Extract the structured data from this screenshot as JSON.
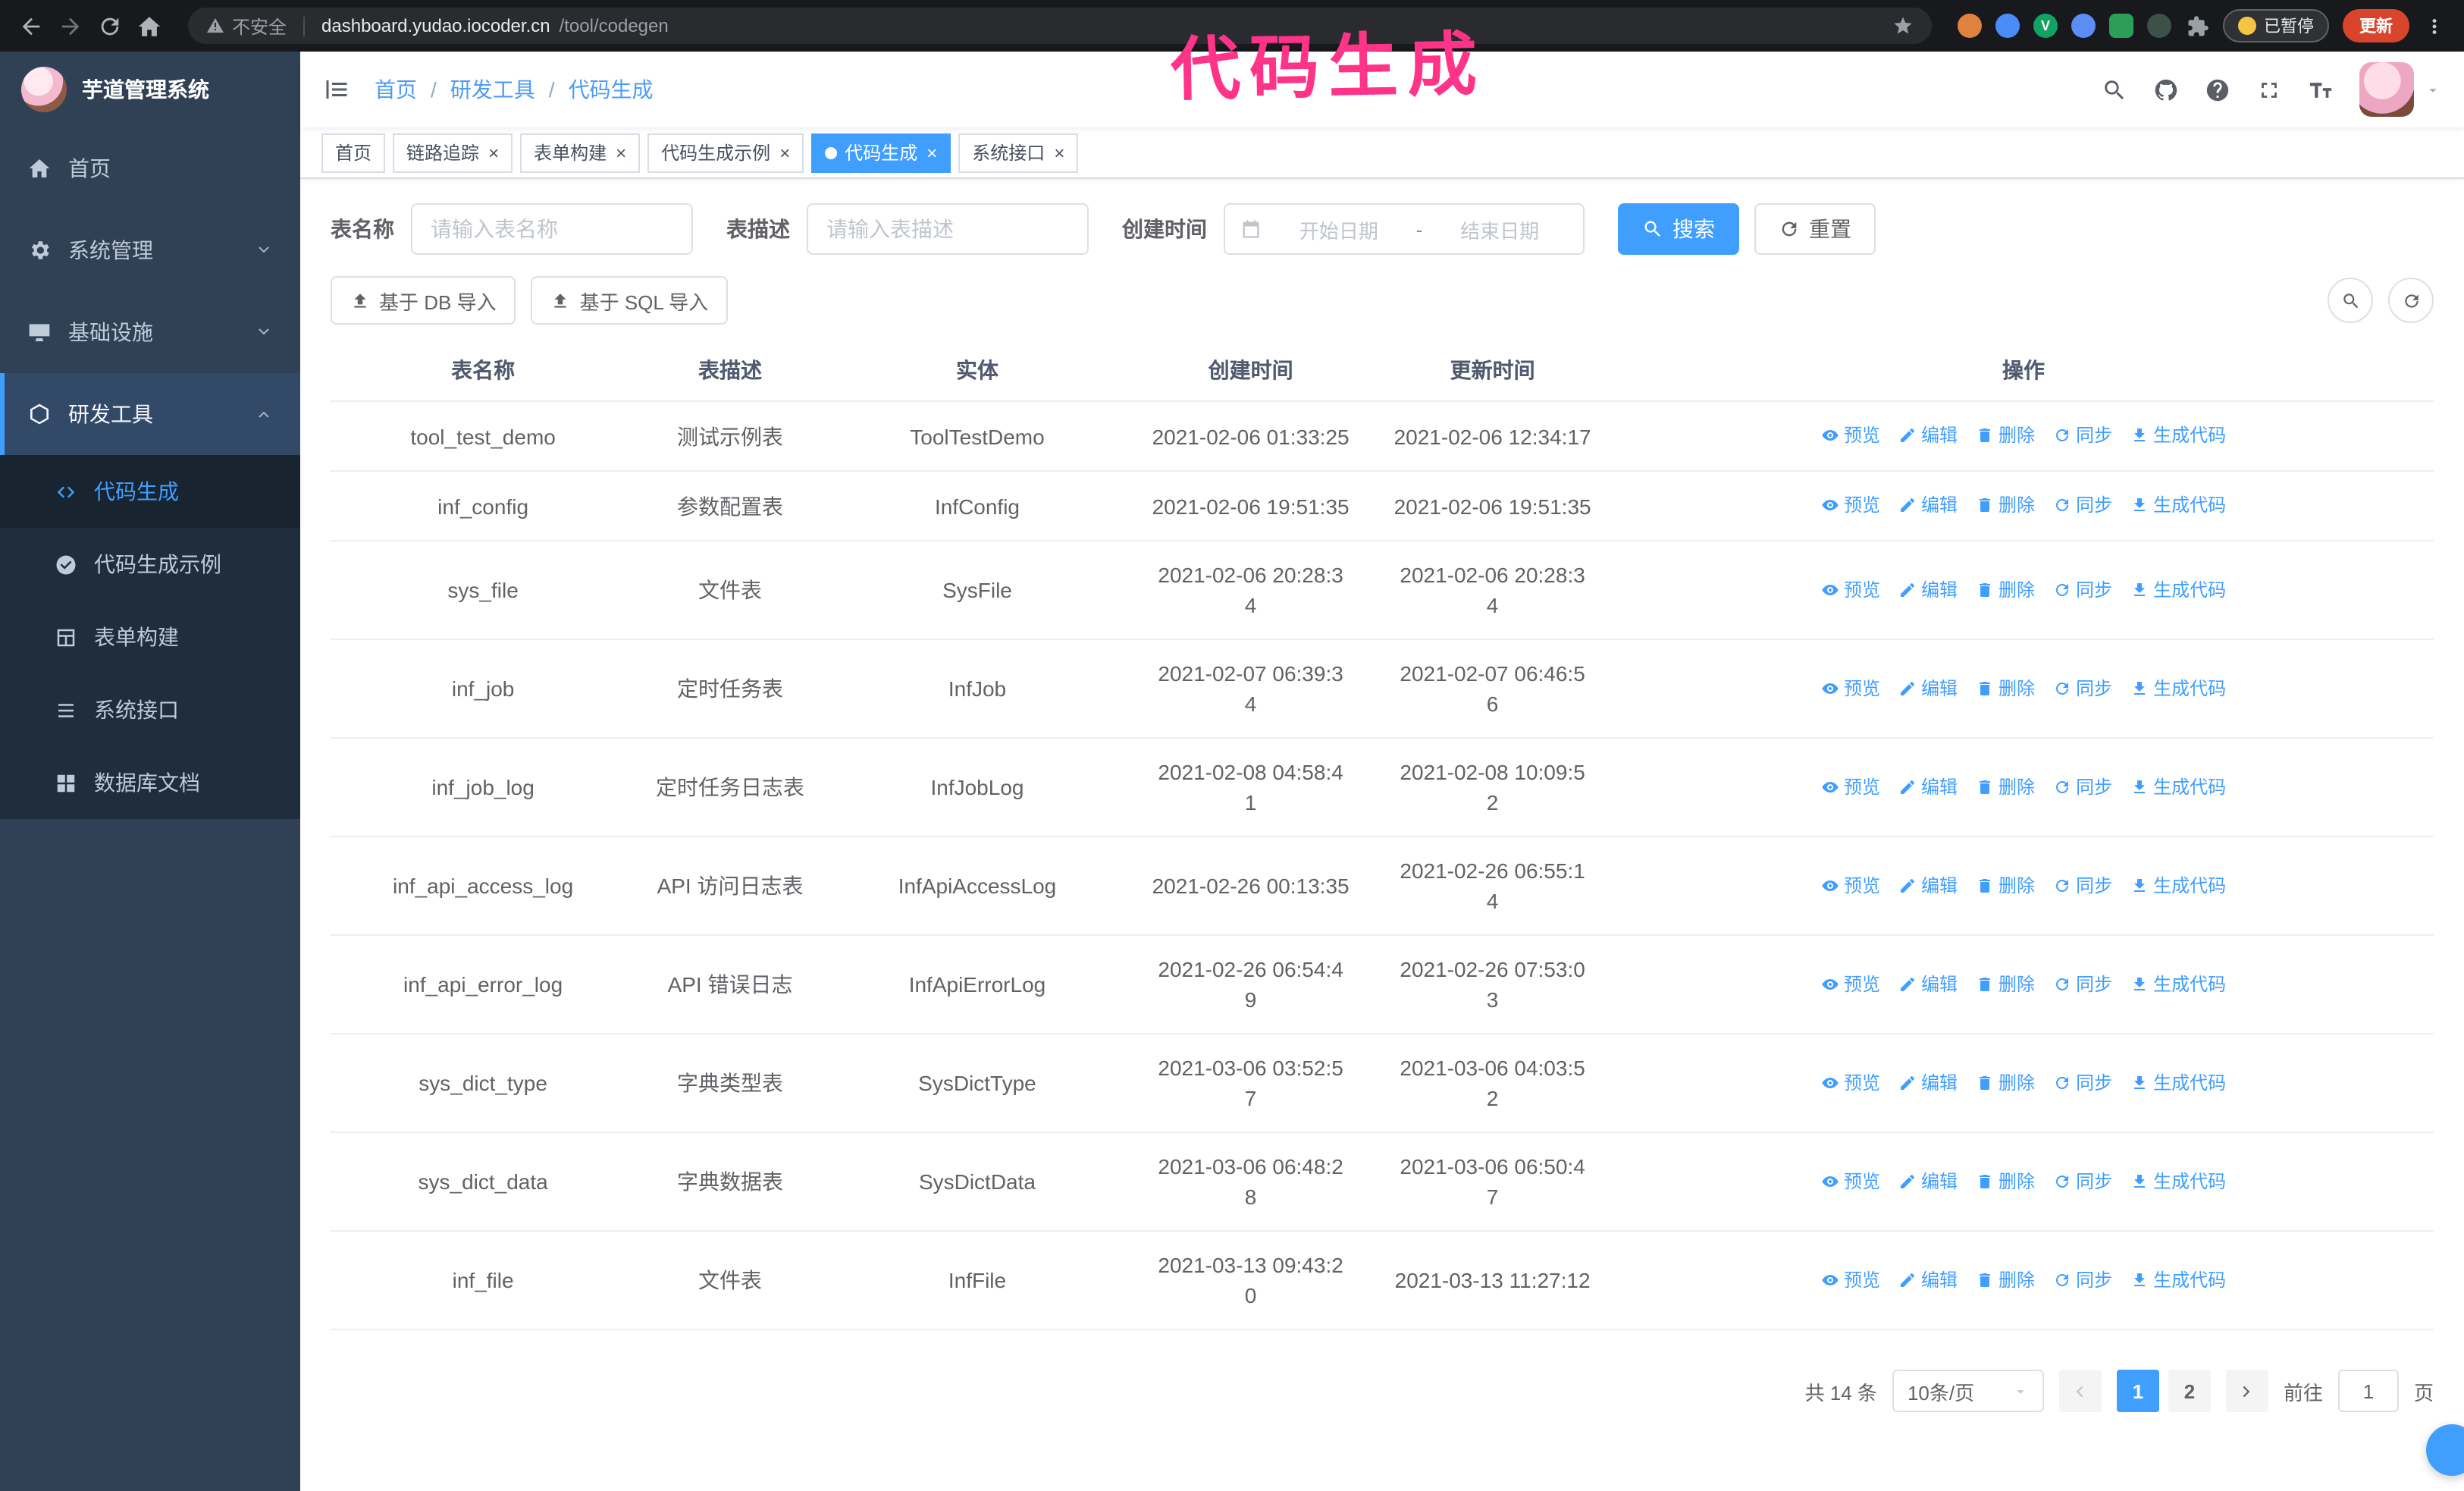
{
  "browser": {
    "security_warning": "不安全",
    "url_host": "dashboard.yudao.iocoder.cn",
    "url_path": "/tool/codegen",
    "paused_badge": "已暂停",
    "update_button": "更新",
    "extensions": [
      {
        "name": "extension-orange",
        "color": "#e0823d",
        "shape": "circle",
        "glyph": ""
      },
      {
        "name": "extension-blue",
        "color": "#4a8df8",
        "shape": "circle",
        "glyph": ""
      },
      {
        "name": "extension-green-v",
        "color": "#12a364",
        "shape": "circle",
        "glyph": "V"
      },
      {
        "name": "extension-people",
        "color": "#5b8df5",
        "shape": "circle",
        "glyph": ""
      },
      {
        "name": "extension-green-square",
        "color": "#2c9e57",
        "shape": "square",
        "glyph": ""
      },
      {
        "name": "extension-dark",
        "color": "#3c5148",
        "shape": "circle",
        "glyph": ""
      },
      {
        "name": "extension-puzzle",
        "color": "#9aa0a6",
        "shape": "puzzle",
        "glyph": ""
      }
    ]
  },
  "annotation": {
    "text": "代码生成",
    "color": "#ff3388"
  },
  "sidebar": {
    "title": "芋道管理系统",
    "menu": [
      {
        "key": "home",
        "label": "首页",
        "icon": "home-icon",
        "expandable": false,
        "expanded": false
      },
      {
        "key": "system-management",
        "label": "系统管理",
        "icon": "gear-icon",
        "expandable": true,
        "expanded": false
      },
      {
        "key": "infrastructure",
        "label": "基础设施",
        "icon": "infra-icon",
        "expandable": true,
        "expanded": false
      },
      {
        "key": "dev-tools",
        "label": "研发工具",
        "icon": "tools-icon",
        "expandable": true,
        "expanded": true
      }
    ],
    "submenu": [
      {
        "key": "codegen",
        "label": "代码生成",
        "icon": "code-icon",
        "active": true
      },
      {
        "key": "codegen-example",
        "label": "代码生成示例",
        "icon": "badge-icon",
        "active": false
      },
      {
        "key": "form-builder",
        "label": "表单构建",
        "icon": "form-icon",
        "active": false
      },
      {
        "key": "system-api",
        "label": "系统接口",
        "icon": "list-icon",
        "active": false
      },
      {
        "key": "db-doc",
        "label": "数据库文档",
        "icon": "grid-icon",
        "active": false
      }
    ]
  },
  "header": {
    "breadcrumb": [
      "首页",
      "研发工具",
      "代码生成"
    ]
  },
  "tabs": [
    {
      "key": "home",
      "label": "首页",
      "closable": false,
      "active": false
    },
    {
      "key": "trace",
      "label": "链路追踪",
      "closable": true,
      "active": false
    },
    {
      "key": "form-builder",
      "label": "表单构建",
      "closable": true,
      "active": false
    },
    {
      "key": "codegen-example",
      "label": "代码生成示例",
      "closable": true,
      "active": false
    },
    {
      "key": "codegen",
      "label": "代码生成",
      "closable": true,
      "active": true
    },
    {
      "key": "system-api",
      "label": "系统接口",
      "closable": true,
      "active": false
    }
  ],
  "filters": {
    "table_name_label": "表名称",
    "table_name_placeholder": "请输入表名称",
    "table_desc_label": "表描述",
    "table_desc_placeholder": "请输入表描述",
    "create_time_label": "创建时间",
    "date_start_placeholder": "开始日期",
    "date_separator": "-",
    "date_end_placeholder": "结束日期",
    "search_button": "搜索",
    "reset_button": "重置"
  },
  "toolbar": {
    "import_db_button": "基于 DB 导入",
    "import_sql_button": "基于 SQL 导入"
  },
  "table": {
    "columns": [
      "表名称",
      "表描述",
      "实体",
      "创建时间",
      "更新时间",
      "操作"
    ],
    "row_actions": [
      {
        "key": "preview",
        "label": "预览",
        "icon": "eye-icon"
      },
      {
        "key": "edit",
        "label": "编辑",
        "icon": "edit-icon"
      },
      {
        "key": "delete",
        "label": "删除",
        "icon": "delete-icon"
      },
      {
        "key": "sync",
        "label": "同步",
        "icon": "sync-icon"
      },
      {
        "key": "generate-code",
        "label": "生成代码",
        "icon": "download-icon"
      }
    ],
    "rows": [
      {
        "name": "tool_test_demo",
        "desc": "测试示例表",
        "entity": "ToolTestDemo",
        "created": "2021-02-06 01:33:25",
        "updated": "2021-02-06 12:34:17"
      },
      {
        "name": "inf_config",
        "desc": "参数配置表",
        "entity": "InfConfig",
        "created": "2021-02-06 19:51:35",
        "updated": "2021-02-06 19:51:35"
      },
      {
        "name": "sys_file",
        "desc": "文件表",
        "entity": "SysFile",
        "created": "2021-02-06 20:28:3\n4",
        "updated": "2021-02-06 20:28:3\n4"
      },
      {
        "name": "inf_job",
        "desc": "定时任务表",
        "entity": "InfJob",
        "created": "2021-02-07 06:39:3\n4",
        "updated": "2021-02-07 06:46:5\n6"
      },
      {
        "name": "inf_job_log",
        "desc": "定时任务日志表",
        "entity": "InfJobLog",
        "created": "2021-02-08 04:58:4\n1",
        "updated": "2021-02-08 10:09:5\n2"
      },
      {
        "name": "inf_api_access_log",
        "desc": "API 访问日志表",
        "entity": "InfApiAccessLog",
        "created": "2021-02-26 00:13:35",
        "updated": "2021-02-26 06:55:1\n4"
      },
      {
        "name": "inf_api_error_log",
        "desc": "API 错误日志",
        "entity": "InfApiErrorLog",
        "created": "2021-02-26 06:54:4\n9",
        "updated": "2021-02-26 07:53:0\n3"
      },
      {
        "name": "sys_dict_type",
        "desc": "字典类型表",
        "entity": "SysDictType",
        "created": "2021-03-06 03:52:5\n7",
        "updated": "2021-03-06 04:03:5\n2"
      },
      {
        "name": "sys_dict_data",
        "desc": "字典数据表",
        "entity": "SysDictData",
        "created": "2021-03-06 06:48:2\n8",
        "updated": "2021-03-06 06:50:4\n7"
      },
      {
        "name": "inf_file",
        "desc": "文件表",
        "entity": "InfFile",
        "created": "2021-03-13 09:43:2\n0",
        "updated": "2021-03-13 11:27:12"
      }
    ]
  },
  "pagination": {
    "total_text": "共 14 条",
    "page_size": "10条/页",
    "pages": [
      "1",
      "2"
    ],
    "active_page": "1",
    "goto_label": "前往",
    "goto_value": "1",
    "goto_unit": "页"
  },
  "ui": {
    "close_glyph": "×",
    "breadcrumb_separator": "/"
  },
  "colors": {
    "primary": "#409EFF",
    "sidebar_bg": "#304156",
    "submenu_bg": "#1f2d3d",
    "annotation": "#ff3388",
    "update_button": "#d9452c"
  }
}
